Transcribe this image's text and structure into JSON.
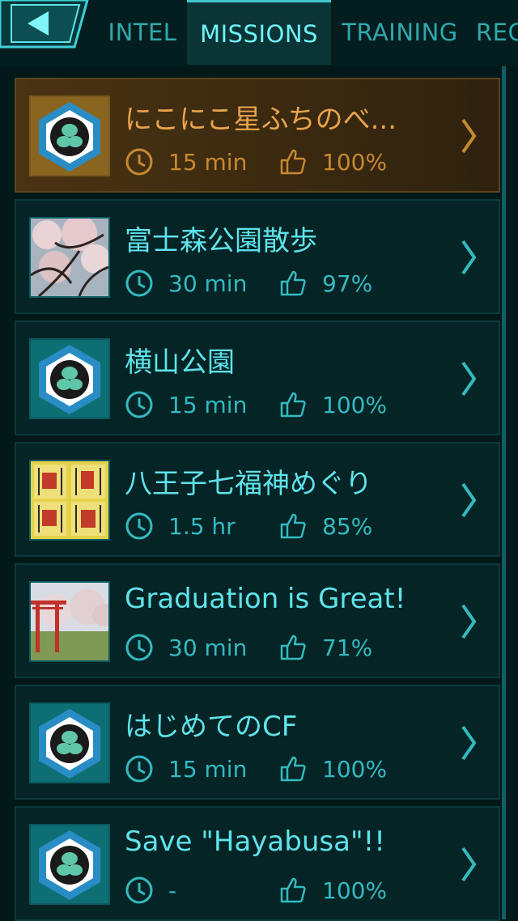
{
  "nav": {
    "back_icon": "back-arrow-icon",
    "tabs": [
      {
        "label": "INTEL",
        "active": false
      },
      {
        "label": "MISSIONS",
        "active": true
      },
      {
        "label": "TRAINING",
        "active": false
      },
      {
        "label": "REC",
        "active": false
      }
    ]
  },
  "colors": {
    "accent": "#5fe3ea",
    "selected": "#e9a34b",
    "row_bg": "#042426"
  },
  "missions": [
    {
      "title": "にこにこ星ふちのべ...",
      "duration": "15 min",
      "rating": "100%",
      "thumb": "mission-badge",
      "selected": true
    },
    {
      "title": "富士森公園散歩",
      "duration": "30 min",
      "rating": "97%",
      "thumb": "cherry-blossom-photo",
      "selected": false
    },
    {
      "title": "横山公園",
      "duration": "15 min",
      "rating": "100%",
      "thumb": "mission-badge",
      "selected": false
    },
    {
      "title": "八王子七福神めぐり",
      "duration": "1.5 hr",
      "rating": "85%",
      "thumb": "shrine-stamp-photo",
      "selected": false
    },
    {
      "title": "Graduation is Great!",
      "duration": "30 min",
      "rating": "71%",
      "thumb": "torii-park-photo",
      "selected": false
    },
    {
      "title": "はじめてのCF",
      "duration": "15 min",
      "rating": "100%",
      "thumb": "mission-badge",
      "selected": false
    },
    {
      "title": "Save \"Hayabusa\"!!",
      "duration": "-",
      "rating": "100%",
      "thumb": "mission-badge",
      "selected": false
    }
  ]
}
